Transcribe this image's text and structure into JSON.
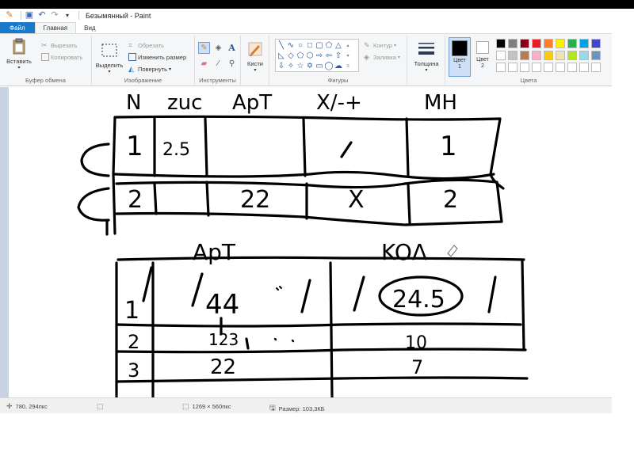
{
  "window": {
    "title": "Безымянный - Paint"
  },
  "tabs": {
    "file": "Файл",
    "home": "Главная",
    "view": "Вид"
  },
  "ribbon": {
    "clipboard": {
      "paste": "Вставить",
      "cut": "Вырезать",
      "copy": "Копировать",
      "label": "Буфер обмена"
    },
    "image": {
      "select": "Выделить",
      "crop": "Обрезать",
      "resize": "Изменить размер",
      "rotate": "Повернуть",
      "label": "Изображение"
    },
    "tools": {
      "label": "Инструменты"
    },
    "brushes": {
      "label": "Кисти"
    },
    "shapes": {
      "outline": "Контур",
      "fill": "Заливка",
      "label": "Фигуры"
    },
    "size": {
      "label": "Толщина"
    },
    "colors": {
      "color1": "Цвет 1",
      "color2": "Цвет 2",
      "label": "Цвета",
      "color1_value": "#000000",
      "color2_value": "#ffffff",
      "palette": [
        "#000000",
        "#7f7f7f",
        "#880015",
        "#ed1c24",
        "#ff7f27",
        "#fff200",
        "#22b14c",
        "#00a2e8",
        "#3f48cc",
        "#ffffff",
        "#c3c3c3",
        "#b97a57",
        "#ffaec9",
        "#ffc90e",
        "#efe4b0",
        "#b5e61d",
        "#99d9ea",
        "#7092be",
        "#ffffff",
        "#ffffff",
        "#ffffff",
        "#ffffff",
        "#ffffff",
        "#ffffff",
        "#ffffff",
        "#ffffff",
        "#ffffff"
      ]
    }
  },
  "drawing": {
    "table1_headers": [
      "N",
      "zuc",
      "ApT",
      "X/-+",
      "MH"
    ],
    "table1_row1": [
      "1",
      "2.5",
      "",
      "/",
      "1"
    ],
    "table1_row2": [
      "2",
      "",
      "22",
      "X",
      "2"
    ],
    "table2_headers": [
      "ApT",
      "KOΛ"
    ],
    "table2_row1": [
      "1",
      "44",
      "24.5"
    ],
    "table2_row2": [
      "2",
      "123",
      "10"
    ],
    "table2_row3": [
      "3",
      "22",
      "7"
    ]
  },
  "statusbar": {
    "cursor_pos": "780, 294пкс",
    "image_size": "1269 × 560пкс",
    "file_size": "Размер: 103,3КБ"
  }
}
